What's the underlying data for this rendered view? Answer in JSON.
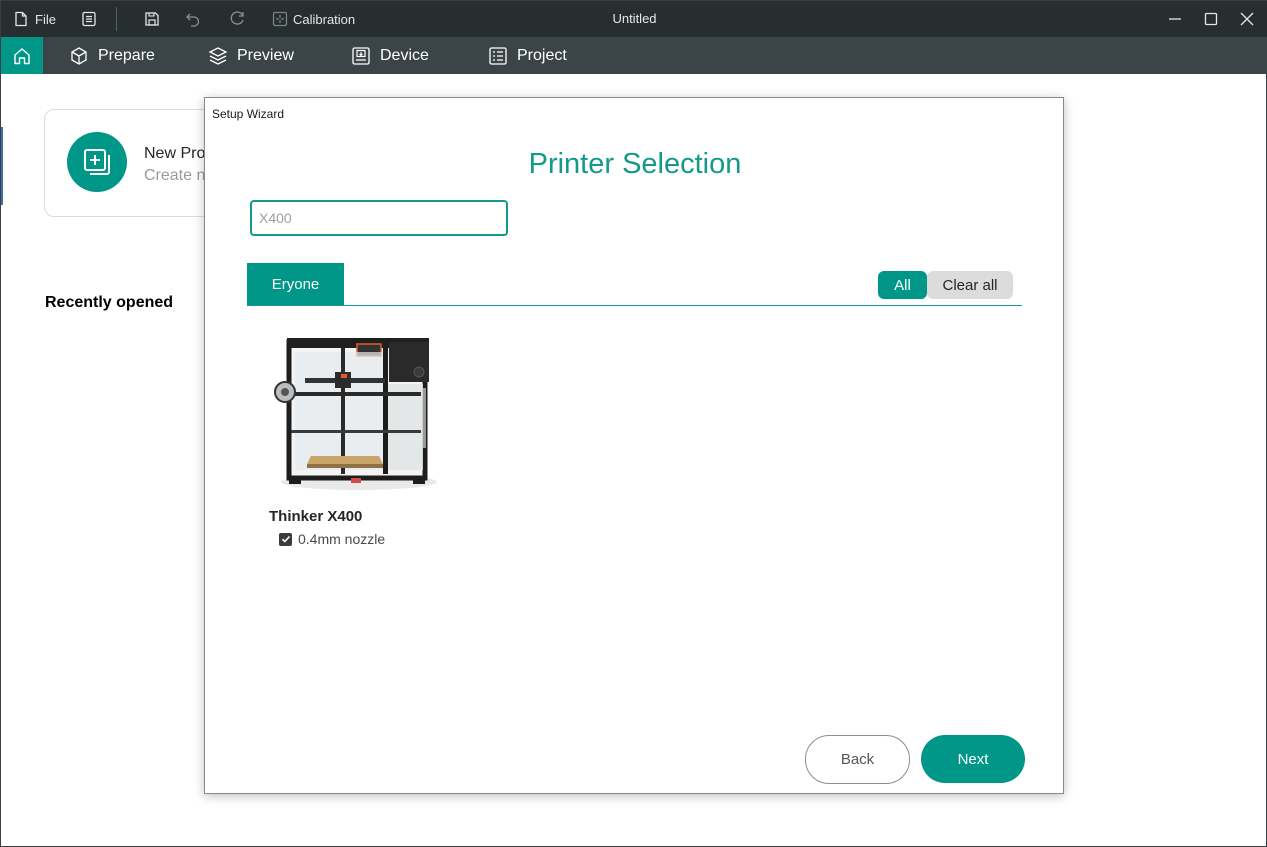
{
  "titlebar": {
    "file_label": "File",
    "calibration_label": "Calibration",
    "window_title": "Untitled"
  },
  "navbar": {
    "tabs": [
      {
        "label": "Prepare",
        "icon": "cube-icon"
      },
      {
        "label": "Preview",
        "icon": "layers-icon"
      },
      {
        "label": "Device",
        "icon": "device-icon"
      },
      {
        "label": "Project",
        "icon": "project-icon"
      }
    ]
  },
  "home": {
    "new_project_title": "New Pro",
    "new_project_subtitle": "Create n",
    "recently_opened": "Recently opened"
  },
  "dialog": {
    "title": "Setup Wizard",
    "heading": "Printer Selection",
    "search_value": "X400",
    "vendor_tab": "Eryone",
    "all_label": "All",
    "clear_all_label": "Clear all",
    "printers": [
      {
        "name": "Thinker X400",
        "nozzles": [
          {
            "label": "0.4mm nozzle",
            "checked": true
          }
        ]
      }
    ],
    "back_label": "Back",
    "next_label": "Next"
  },
  "colors": {
    "accent": "#009688",
    "titlebar_bg": "#262e30",
    "navbar_bg": "#3b4446"
  }
}
